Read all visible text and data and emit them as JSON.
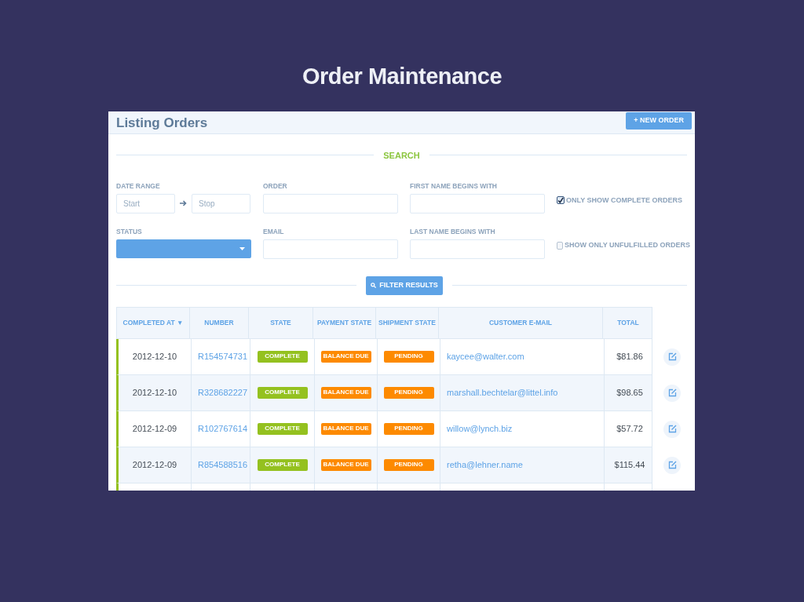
{
  "slide_title": "Order Maintenance",
  "header": {
    "title": "Listing Orders",
    "new_order_button": "+ NEW ORDER"
  },
  "search": {
    "heading": "SEARCH",
    "fields": [
      {
        "kind": "range",
        "label": "DATE RANGE",
        "start_placeholder": "Start",
        "stop_placeholder": "Stop"
      },
      {
        "kind": "text",
        "label": "ORDER"
      },
      {
        "kind": "text",
        "label": "FIRST NAME BEGINS WITH"
      },
      {
        "kind": "checkbox",
        "label": "ONLY SHOW COMPLETE ORDERS",
        "checked": true
      },
      {
        "kind": "select",
        "label": "STATUS"
      },
      {
        "kind": "text",
        "label": "EMAIL"
      },
      {
        "kind": "text",
        "label": "LAST NAME BEGINS WITH"
      },
      {
        "kind": "checkbox",
        "label": "SHOW ONLY UNFULFILLED ORDERS",
        "checked": false
      }
    ],
    "filter_button": "FILTER RESULTS"
  },
  "table": {
    "columns": [
      "COMPLETED AT ▼",
      "NUMBER",
      "STATE",
      "PAYMENT STATE",
      "SHIPMENT STATE",
      "CUSTOMER E-MAIL",
      "TOTAL"
    ],
    "rows": [
      {
        "completed_at": "2012-12-10",
        "number": "R154574731",
        "state": {
          "kind": "complete",
          "text": "COMPLETE"
        },
        "payment_state": {
          "kind": "warning",
          "text": "BALANCE DUE"
        },
        "shipment_state": {
          "kind": "warning",
          "text": "PENDING"
        },
        "email": "kaycee@walter.com",
        "total": "$81.86"
      },
      {
        "completed_at": "2012-12-10",
        "number": "R328682227",
        "state": {
          "kind": "complete",
          "text": "COMPLETE"
        },
        "payment_state": {
          "kind": "warning",
          "text": "BALANCE DUE"
        },
        "shipment_state": {
          "kind": "warning",
          "text": "PENDING"
        },
        "email": "marshall.bechtelar@littel.info",
        "total": "$98.65"
      },
      {
        "completed_at": "2012-12-09",
        "number": "R102767614",
        "state": {
          "kind": "complete",
          "text": "COMPLETE"
        },
        "payment_state": {
          "kind": "warning",
          "text": "BALANCE DUE"
        },
        "shipment_state": {
          "kind": "warning",
          "text": "PENDING"
        },
        "email": "willow@lynch.biz",
        "total": "$57.72"
      },
      {
        "completed_at": "2012-12-09",
        "number": "R854588516",
        "state": {
          "kind": "complete",
          "text": "COMPLETE"
        },
        "payment_state": {
          "kind": "warning",
          "text": "BALANCE DUE"
        },
        "shipment_state": {
          "kind": "warning",
          "text": "PENDING"
        },
        "email": "retha@lehner.name",
        "total": "$115.44"
      }
    ]
  }
}
